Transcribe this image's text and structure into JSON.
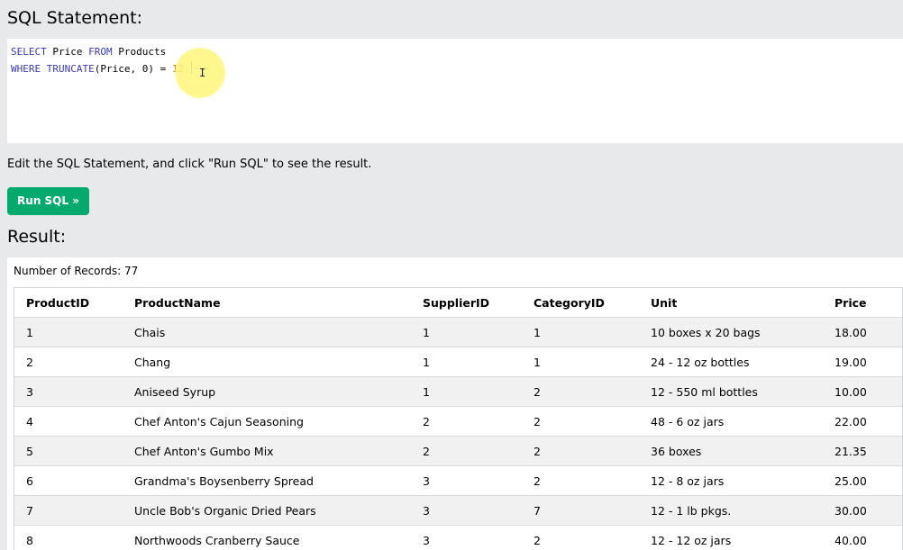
{
  "sql_section": {
    "heading": "SQL Statement:",
    "query": {
      "line1": {
        "k1": "SELECT",
        "t1": " Price ",
        "k2": "FROM",
        "t2": " Products"
      },
      "line2": {
        "k1": "WHERE",
        "t1": " ",
        "k2": "TRUNCATE",
        "t2": "(Price, 0) = ",
        "n1": "12;"
      }
    }
  },
  "instruction": "Edit the SQL Statement, and click \"Run SQL\" to see the result.",
  "run_button_label": "Run SQL »",
  "result_section": {
    "heading": "Result:",
    "records_label": "Number of Records: 77",
    "columns": [
      "ProductID",
      "ProductName",
      "SupplierID",
      "CategoryID",
      "Unit",
      "Price"
    ],
    "rows": [
      [
        "1",
        "Chais",
        "1",
        "1",
        "10 boxes x 20 bags",
        "18.00"
      ],
      [
        "2",
        "Chang",
        "1",
        "1",
        "24 - 12 oz bottles",
        "19.00"
      ],
      [
        "3",
        "Aniseed Syrup",
        "1",
        "2",
        "12 - 550 ml bottles",
        "10.00"
      ],
      [
        "4",
        "Chef Anton's Cajun Seasoning",
        "2",
        "2",
        "48 - 6 oz jars",
        "22.00"
      ],
      [
        "5",
        "Chef Anton's Gumbo Mix",
        "2",
        "2",
        "36 boxes",
        "21.35"
      ],
      [
        "6",
        "Grandma's Boysenberry Spread",
        "3",
        "2",
        "12 - 8 oz jars",
        "25.00"
      ],
      [
        "7",
        "Uncle Bob's Organic Dried Pears",
        "3",
        "7",
        "12 - 1 lb pkgs.",
        "30.00"
      ],
      [
        "8",
        "Northwoods Cranberry Sauce",
        "3",
        "2",
        "12 - 12 oz jars",
        "40.00"
      ]
    ]
  },
  "colors": {
    "page_bg": "#e7e9eb",
    "run_button": "#04aa6d",
    "sql_keyword": "#3b3bab",
    "sql_number": "#b8860b",
    "row_stripe": "#f1f1f1"
  }
}
